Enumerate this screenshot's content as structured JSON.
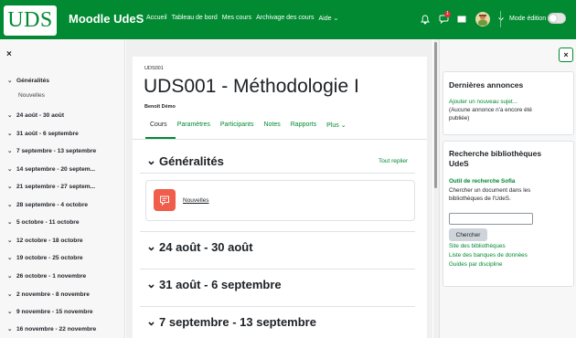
{
  "header": {
    "logo_text": "UDS",
    "site_name": "Moodle UdeS",
    "nav": [
      "Accueil",
      "Tableau de bord",
      "Mes cours",
      "Archivage des cours",
      "Aide ⌄"
    ],
    "notification_count": "1",
    "edit_mode_label": "Mode édition",
    "edit_mode_on": false
  },
  "drawer": {
    "close": "×",
    "items": [
      {
        "label": "Généralités",
        "chev": "⌄"
      },
      {
        "label": "Nouvelles",
        "chev": ""
      },
      {
        "label": "24 août - 30 août",
        "chev": "⌄"
      },
      {
        "label": "31 août - 6 septembre",
        "chev": "⌄"
      },
      {
        "label": "7 septembre - 13 septembre",
        "chev": "⌄"
      },
      {
        "label": "14 septembre - 20 septem...",
        "chev": "⌄"
      },
      {
        "label": "21 septembre - 27 septem...",
        "chev": "⌄"
      },
      {
        "label": "28 septembre - 4 octobre",
        "chev": "⌄"
      },
      {
        "label": "5 octobre - 11 octobre",
        "chev": "⌄"
      },
      {
        "label": "12 octobre - 18 octobre",
        "chev": "⌄"
      },
      {
        "label": "19 octobre - 25 octobre",
        "chev": "⌄"
      },
      {
        "label": "26 octobre - 1 novembre",
        "chev": "⌄"
      },
      {
        "label": "2 novembre - 8 novembre",
        "chev": "⌄"
      },
      {
        "label": "9 novembre - 15 novembre",
        "chev": "⌄"
      },
      {
        "label": "16 novembre - 22 novembre",
        "chev": "⌄"
      }
    ]
  },
  "course": {
    "shortname": "UDS001",
    "title": "UDS001 - Méthodologie I",
    "teacher": "Benoît Démo",
    "tabs": [
      "Cours",
      "Paramètres",
      "Participants",
      "Notes",
      "Rapports",
      "Plus ⌄"
    ],
    "collapse_all": "Tout replier",
    "sections": [
      {
        "chev": "⌄",
        "title": "Généralités"
      },
      {
        "chev": "⌄",
        "title": "24 août - 30 août"
      },
      {
        "chev": "⌄",
        "title": "31 août - 6 septembre"
      },
      {
        "chev": "⌄",
        "title": "7 septembre - 13 septembre"
      }
    ],
    "activity": {
      "name": "Nouvelles",
      "icon": "forum-icon",
      "color": "#f05d4b"
    }
  },
  "right_panel": {
    "close": "×",
    "announcements": {
      "title": "Dernières annonces",
      "add_link": "Ajouter un nouveau sujet...",
      "empty_text_1": "(Aucune annonce n'a encore été",
      "empty_text_2": "publiée)"
    },
    "library": {
      "title_1": "Recherche bibliothèques",
      "title_2": "UdeS",
      "tool": "Outil de recherche Sofia",
      "desc_1": "Chercher un document dans les",
      "desc_2": "bibliothèques de l'UdeS.",
      "search_button": "Chercher",
      "links": [
        "Site des bibliothèques",
        "Liste des banques de données",
        "Guides par discipline"
      ]
    }
  },
  "colors": {
    "brand": "#018a31",
    "forum": "#f05d4b"
  }
}
